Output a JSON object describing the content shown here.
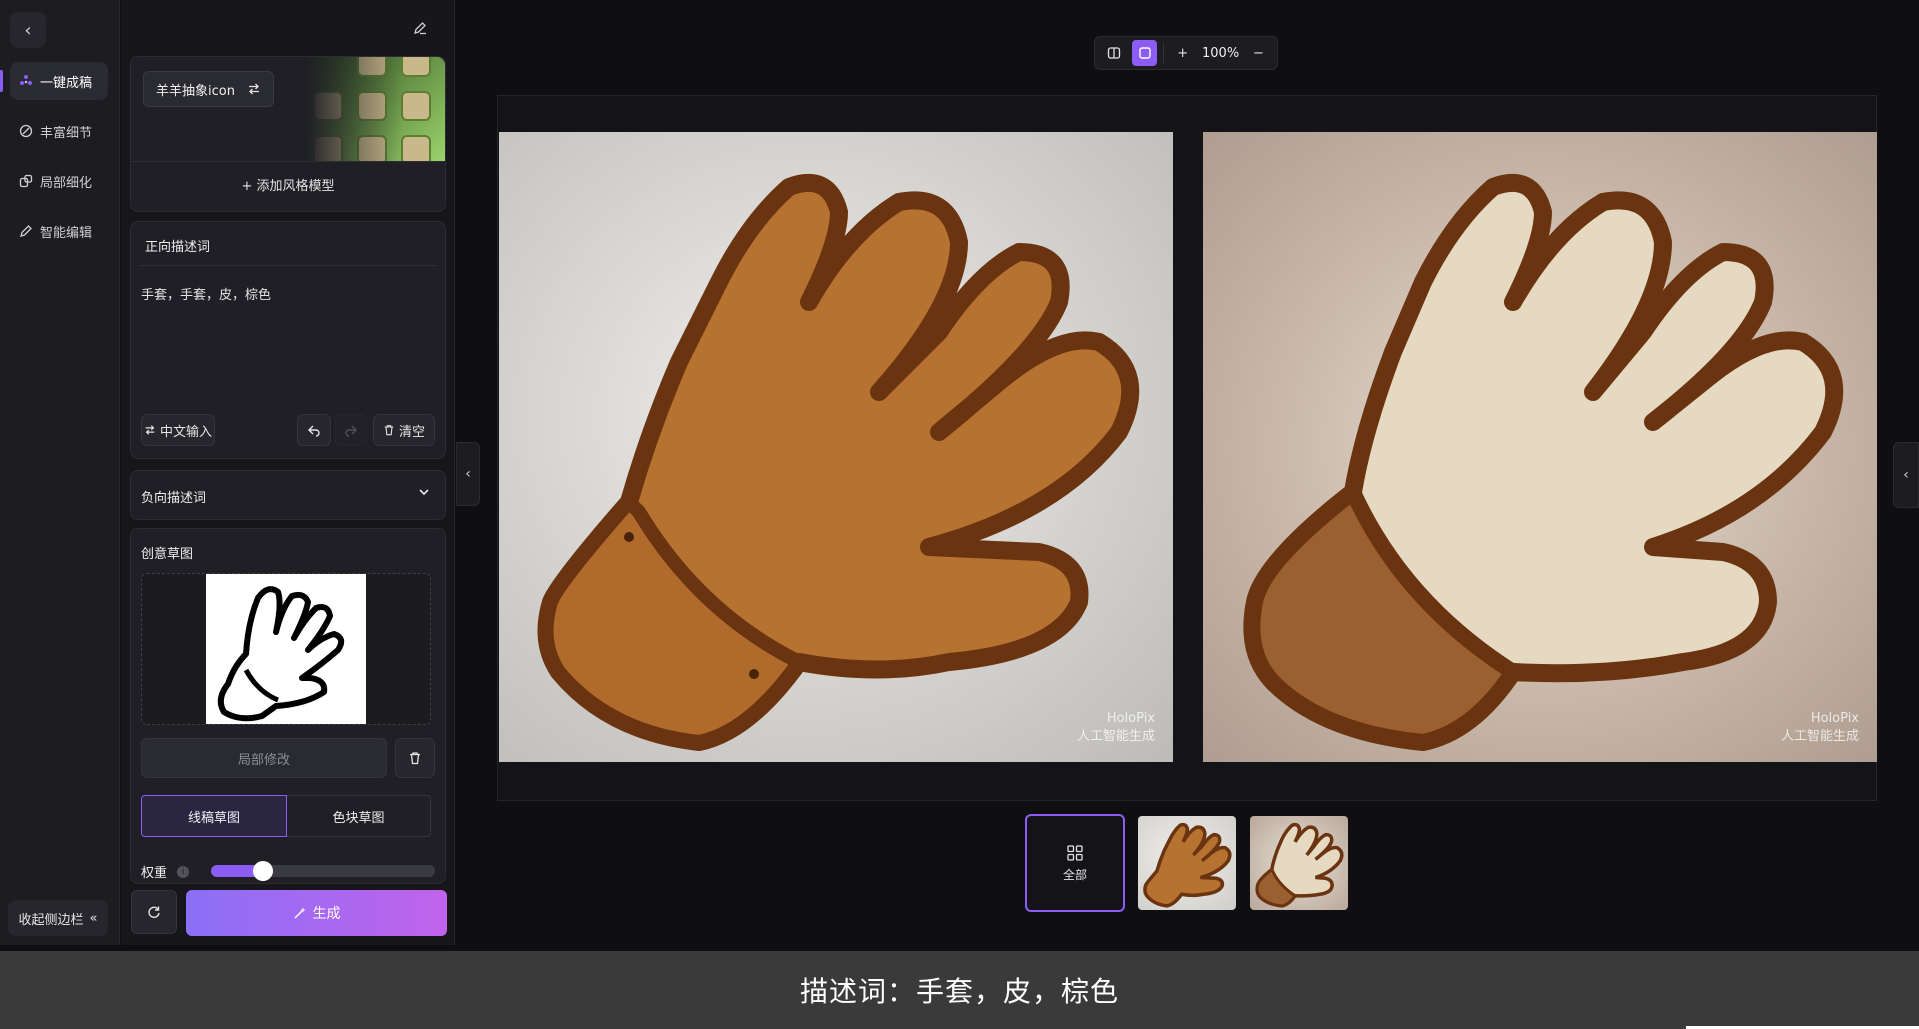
{
  "nav": {
    "items": [
      {
        "label": "一键成稿",
        "icon": "sparkle-dots-icon",
        "active": true
      },
      {
        "label": "丰富细节",
        "icon": "detail-brush-icon",
        "active": false
      },
      {
        "label": "局部细化",
        "icon": "region-refine-icon",
        "active": false
      },
      {
        "label": "智能编辑",
        "icon": "pencil-icon",
        "active": false
      }
    ],
    "collapse_label": "收起侧边栏",
    "collapse_icon": "double-chevron-left-icon"
  },
  "style_model": {
    "tag_label": "羊羊抽象icon",
    "swap_icon": "swap-icon",
    "add_label": "添加风格模型"
  },
  "prompt": {
    "header": "正向描述词",
    "text": "手套，手套，皮，棕色",
    "cn_input_label": "中文输入",
    "clear_label": "清空"
  },
  "negative_prompt": {
    "label": "负向描述词"
  },
  "sketch": {
    "label": "创意草图",
    "local_edit_label": "局部修改",
    "modes": [
      "线稿草图",
      "色块草图"
    ],
    "selected_mode": "线稿草图",
    "weight_label": "权重",
    "weight_value": 0.23
  },
  "actions": {
    "generate_label": "生成"
  },
  "toolbar": {
    "zoom": "100%"
  },
  "canvas": {
    "watermark_line1": "HoloPix",
    "watermark_line2": "人工智能生成"
  },
  "thumbnails": {
    "all_label": "全部"
  },
  "caption": {
    "text": "描述词：手套，皮，棕色"
  },
  "colors": {
    "accent": "#8b5cf6",
    "glove_brown": "#b57231",
    "glove_outline": "#6a3410",
    "glove_cream": "#e6d9c1",
    "cuff_brown": "#9c5f2f"
  }
}
